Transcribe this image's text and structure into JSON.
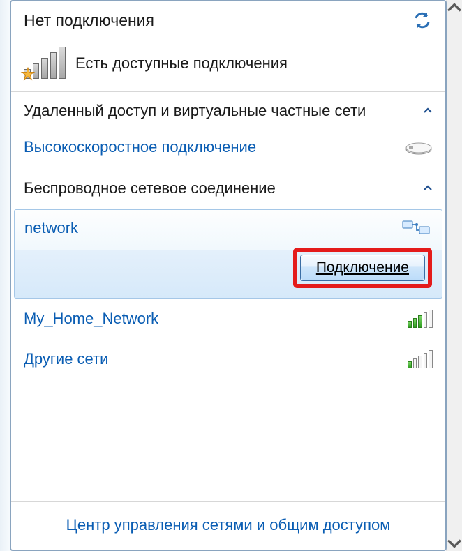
{
  "colors": {
    "link": "#0a5db3",
    "border": "#8aa4bf",
    "highlight": "#e41b1b"
  },
  "header": {
    "status_title": "Нет подключения",
    "available_text": "Есть доступные подключения"
  },
  "dialup_section": {
    "title": "Удаленный доступ и виртуальные частные сети",
    "items": [
      {
        "label": "Высокоскоростное подключение"
      }
    ]
  },
  "wireless_section": {
    "title": "Беспроводное сетевое соединение",
    "selected": {
      "name": "network",
      "connect_button": "Подключение"
    },
    "items": [
      {
        "label": "My_Home_Network",
        "signal": 3
      },
      {
        "label": "Другие сети",
        "signal": 1
      }
    ]
  },
  "footer": {
    "link": "Центр управления сетями и общим доступом"
  }
}
